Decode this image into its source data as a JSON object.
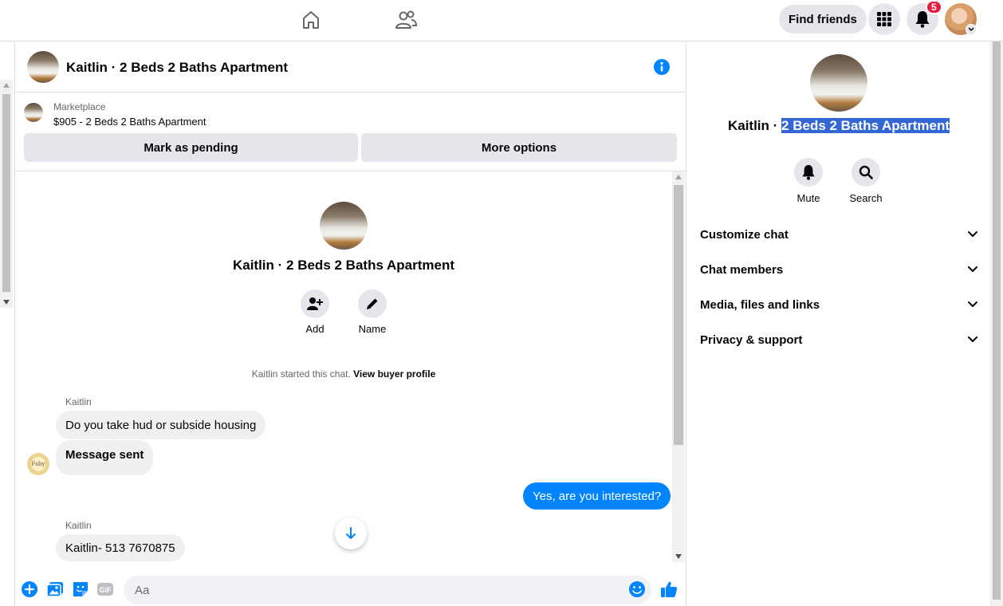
{
  "topbar": {
    "find_friends_label": "Find friends",
    "notification_count": "5"
  },
  "chat": {
    "title": "Kaitlin · 2 Beds 2 Baths Apartment",
    "marketplace": {
      "label": "Marketplace",
      "listing": "$905 - 2 Beds 2 Baths Apartment",
      "mark_pending_label": "Mark as pending",
      "more_options_label": "More options"
    },
    "intro": {
      "name": "Kaitlin · 2 Beds 2 Baths Apartment",
      "add_label": "Add",
      "name_label": "Name",
      "started_text": "Kaitlin started this chat.",
      "view_buyer_label": "View buyer profile"
    },
    "messages": [
      {
        "sender": "Kaitlin",
        "text": "Do you take hud or subside housing"
      },
      {
        "text": "Message sent"
      },
      {
        "text": "Yes, are you interested?",
        "outgoing": true
      },
      {
        "sender": "Kaitlin",
        "text": "Kaitlin- 513 7670875"
      }
    ],
    "small_avatar_text": "Fshy",
    "composer": {
      "placeholder": "Aa"
    }
  },
  "right_panel": {
    "name_prefix": "Kaitlin · ",
    "name_highlight": "2 Beds 2 Baths Apartment",
    "mute_label": "Mute",
    "search_label": "Search",
    "sections": [
      "Customize chat",
      "Chat members",
      "Media, files and links",
      "Privacy & support"
    ]
  },
  "colors": {
    "accent": "#0084ff",
    "badge": "#e41e3f",
    "selection": "#3367d6"
  }
}
